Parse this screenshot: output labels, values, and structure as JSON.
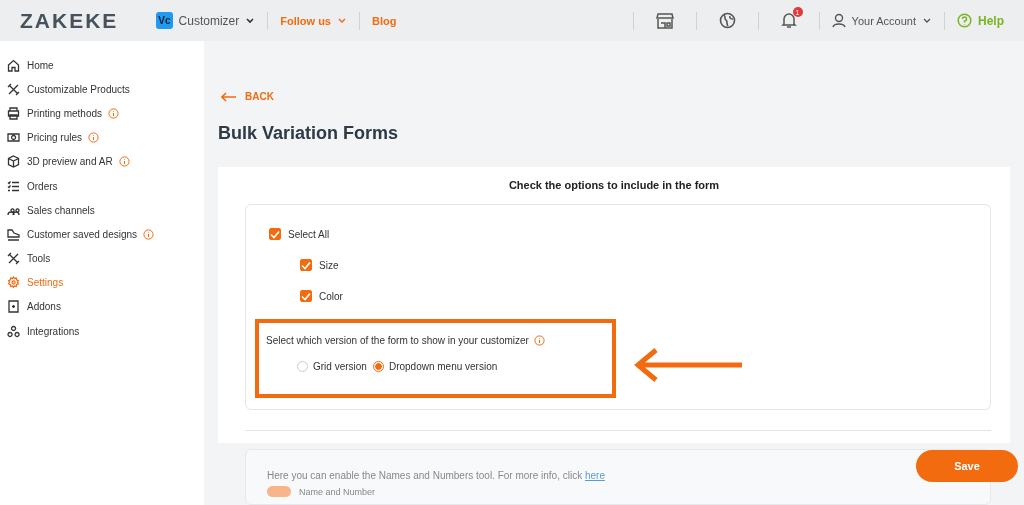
{
  "header": {
    "logo": "ZAKEKE",
    "app_badge": "Vc",
    "app_menu": "Customizer",
    "follow": "Follow us",
    "blog": "Blog",
    "notifications": "1",
    "account": "Your Account",
    "help": "Help"
  },
  "sidebar": {
    "items": [
      {
        "label": "Home",
        "kind": "home",
        "info": false,
        "selected": false
      },
      {
        "label": "Customizable Products",
        "kind": "tools",
        "info": false,
        "selected": false
      },
      {
        "label": "Printing methods",
        "kind": "printer",
        "info": true,
        "selected": false
      },
      {
        "label": "Pricing rules",
        "kind": "money",
        "info": true,
        "selected": false
      },
      {
        "label": "3D preview and AR",
        "kind": "cube",
        "info": true,
        "selected": false
      },
      {
        "label": "Orders",
        "kind": "list",
        "info": false,
        "selected": false
      },
      {
        "label": "Sales channels",
        "kind": "people",
        "info": false,
        "selected": false
      },
      {
        "label": "Customer saved designs",
        "kind": "shoe",
        "info": true,
        "selected": false
      },
      {
        "label": "Tools",
        "kind": "tools",
        "info": false,
        "selected": false
      },
      {
        "label": "Settings",
        "kind": "gear",
        "info": false,
        "selected": true
      },
      {
        "label": "Addons",
        "kind": "addon",
        "info": false,
        "selected": false
      },
      {
        "label": "Integrations",
        "kind": "nodes",
        "info": false,
        "selected": false
      }
    ]
  },
  "back": "BACK",
  "title": "Bulk Variation Forms",
  "form": {
    "heading": "Check the options to include in the form",
    "select_all": {
      "label": "Select All",
      "checked": true
    },
    "options": [
      {
        "label": "Size",
        "checked": true
      },
      {
        "label": "Color",
        "checked": true
      }
    ],
    "version_prompt": "Select which version of the form to show in your customizer",
    "versions": [
      {
        "label": "Grid version",
        "selected": false
      },
      {
        "label": "Dropdown menu version",
        "selected": true
      }
    ]
  },
  "names_panel": {
    "text": "Here you can enable the Names and Numbers tool. For more info, click ",
    "link": "here",
    "toggle": {
      "label": "Name and Number",
      "on": true
    }
  },
  "save": "Save"
}
